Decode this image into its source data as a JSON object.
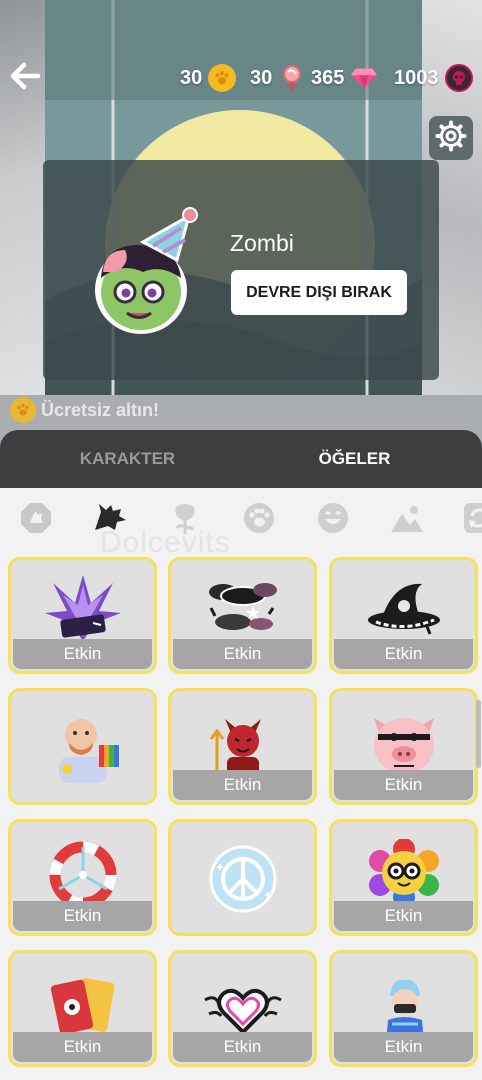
{
  "header": {
    "back_icon": "arrow-left-icon",
    "currencies": [
      {
        "name": "gold",
        "value": "30",
        "icon": "paw-coin-icon",
        "color": "#f5b921"
      },
      {
        "name": "candy",
        "value": "30",
        "icon": "lollipop-icon",
        "color": "#e8777f"
      },
      {
        "name": "gems",
        "value": "365",
        "icon": "gem-icon",
        "color": "#f04e87"
      },
      {
        "name": "skulls",
        "value": "1003",
        "icon": "skull-coin-icon",
        "color": "#c2185b"
      }
    ],
    "settings_icon": "gear-icon"
  },
  "character": {
    "name": "Zombi",
    "deactivate_label": "DEVRE DIŞI BIRAK",
    "avatar": "zombie-party-avatar"
  },
  "free_gold": {
    "label": "Ücretsiz altın!",
    "icon": "paw-coin-icon"
  },
  "tabs": [
    {
      "label": "KARAKTER",
      "active": false
    },
    {
      "label": "ÖĞELER",
      "active": true
    }
  ],
  "categories": [
    "stop-sign-icon",
    "wolf-icon",
    "rose-icon",
    "paw-icon",
    "smile-icon",
    "landscape-icon",
    "refresh-icon"
  ],
  "watermark": "Dolcevits",
  "items": [
    {
      "art": "purple-crystal-book",
      "label": "Etkin",
      "show_label": true
    },
    {
      "art": "dark-clouds-stars",
      "label": "Etkin",
      "show_label": true
    },
    {
      "art": "witch-hat",
      "label": "Etkin",
      "show_label": true
    },
    {
      "art": "bald-man-rainbow",
      "label": "",
      "show_label": false
    },
    {
      "art": "red-devil",
      "label": "Etkin",
      "show_label": true
    },
    {
      "art": "pig-face",
      "label": "Etkin",
      "show_label": true
    },
    {
      "art": "lifebuoy",
      "label": "Etkin",
      "show_label": true
    },
    {
      "art": "peace-snowflakes",
      "label": "",
      "show_label": false
    },
    {
      "art": "rainbow-flower-glasses",
      "label": "Etkin",
      "show_label": true
    },
    {
      "art": "red-cards",
      "label": "Etkin",
      "show_label": true
    },
    {
      "art": "tribal-heart",
      "label": "Etkin",
      "show_label": true
    },
    {
      "art": "blue-hair-girl",
      "label": "Etkin",
      "show_label": true
    }
  ],
  "colors": {
    "card_border": "#f2e25c",
    "tabbar": "#3e3e40",
    "active_tab_text": "#ffffff",
    "inactive_tab_text": "#9a9a9c",
    "badge": "#a6a6a6"
  }
}
